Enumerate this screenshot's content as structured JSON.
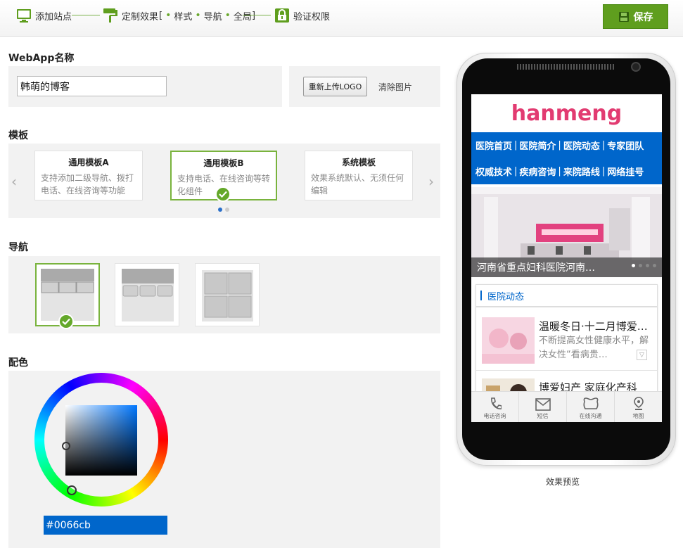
{
  "steps": {
    "step1": "添加站点",
    "step2": "定制效果",
    "step2_open": "[",
    "step2_options": [
      "样式",
      "导航",
      "全局"
    ],
    "step2_close": "]",
    "step3": "验证权限"
  },
  "toolbar": {
    "save_label": "保存"
  },
  "webapp": {
    "section_title": "WebApp名称",
    "name_value": "韩萌的博客",
    "upload_button": "重新上传LOGO",
    "clear_link": "清除图片"
  },
  "template": {
    "section_title": "模板",
    "prev_arrow": "‹",
    "next_arrow": "›",
    "cards": [
      {
        "title": "通用模板A",
        "desc": "支持添加二级导航、拨打电话、在线咨询等功能"
      },
      {
        "title": "通用模板B",
        "desc": "支持电话、在线咨询等转化组件"
      },
      {
        "title": "系统模板",
        "desc": "效果系统默认、无须任何编辑"
      }
    ],
    "selected_index": 1
  },
  "nav": {
    "section_title": "导航",
    "selected_index": 0
  },
  "color": {
    "section_title": "配色",
    "hex_value": "#0066cb",
    "accent": "#0066cb"
  },
  "preview": {
    "logo": "hanmeng",
    "menu_rows": [
      [
        "医院首页",
        "医院简介",
        "医院动态",
        "专家团队"
      ],
      [
        "权威技术",
        "疾病咨询",
        "来院路线",
        "网络挂号"
      ]
    ],
    "banner_caption": "河南省重点妇科医院河南…",
    "news_header": "医院动态",
    "news": [
      {
        "title": "温暖冬日·十二月博爱…",
        "desc": "不断提高女性健康水平，解决女性“看病贵…"
      },
      {
        "title": "博爱妇产 家庭化产科",
        "desc": ""
      }
    ],
    "tabs": [
      "电话咨询",
      "短信",
      "在线沟通",
      "地图"
    ],
    "caption": "效果预览"
  },
  "colors": {
    "brand_green": "#5f9e1e",
    "selected_border": "#79b33d",
    "logo_pink": "#e23b71"
  }
}
